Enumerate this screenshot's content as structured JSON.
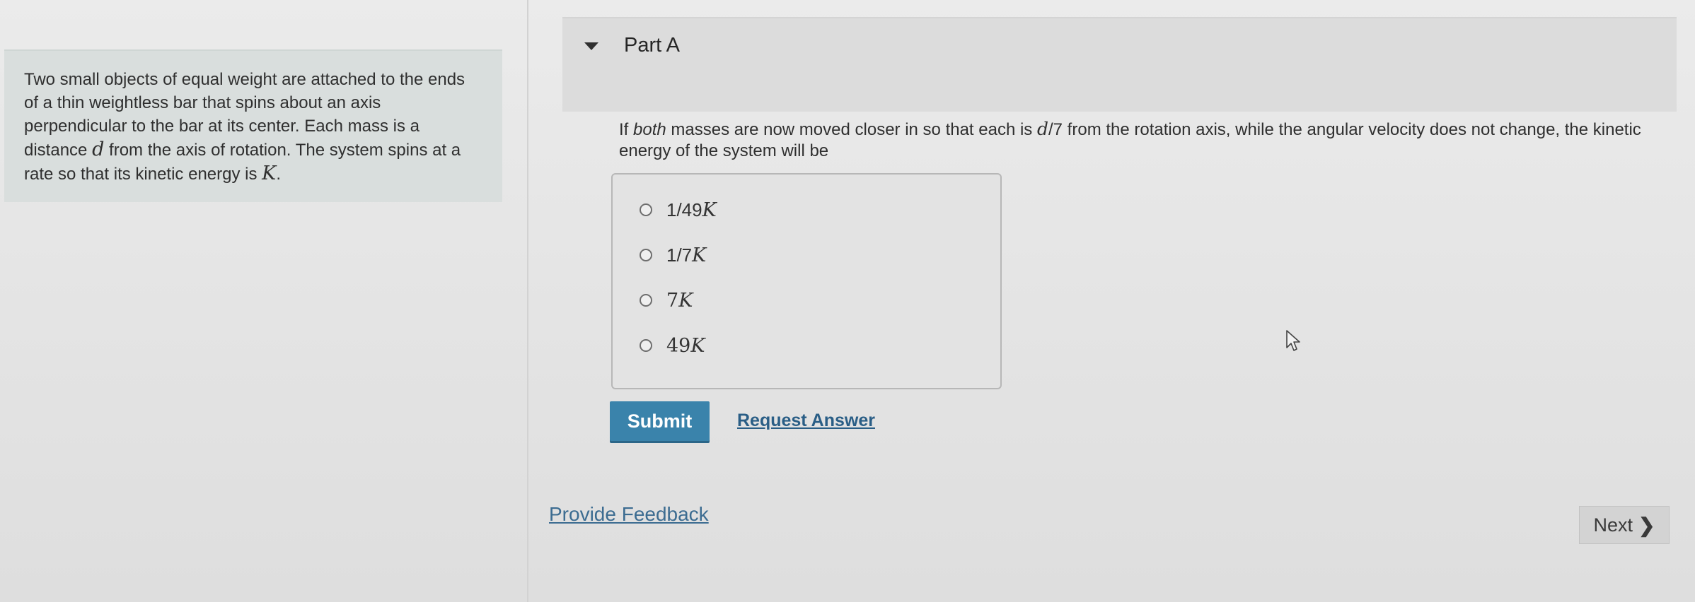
{
  "problem": {
    "text_1": "Two small objects of equal weight are attached to the ends of a thin weightless bar that spins about an axis perpendicular to the bar at its center. Each mass is a distance ",
    "var_d": "d",
    "text_2": " from the axis of rotation. The system spins at a rate so that its kinetic energy is ",
    "var_K": "K",
    "text_3": "."
  },
  "part": {
    "title": "Part A"
  },
  "question": {
    "text_1": "If ",
    "emph": "both",
    "text_2": " masses are now moved closer in so that each is ",
    "var_d": "d",
    "frac": "/7",
    "text_3": " from the rotation axis, while the angular velocity does not change, the kinetic energy of the system will be"
  },
  "choices": [
    {
      "coef": "1/49",
      "var": "K"
    },
    {
      "coef": "1/7",
      "var": "K"
    },
    {
      "coef": "7",
      "var": "K"
    },
    {
      "coef": "49",
      "var": "K"
    }
  ],
  "actions": {
    "submit": "Submit",
    "request_answer": "Request Answer",
    "provide_feedback": "Provide Feedback",
    "next": "Next"
  },
  "icons": {
    "collapse": "caret-down-icon",
    "radio": "radio-button-icon",
    "next": "chevron-right-icon",
    "cursor": "mouse-pointer-icon"
  },
  "colors": {
    "submit_bg": "#3a83ab",
    "link": "#2a5e86",
    "problem_bg": "#d9dedd"
  }
}
